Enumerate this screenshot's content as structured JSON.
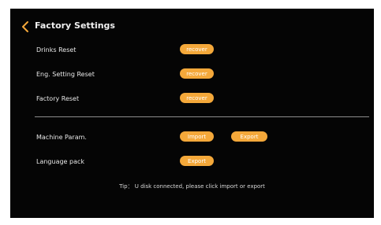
{
  "header": {
    "back_icon": "chevron-left-icon",
    "title": "Factory Settings"
  },
  "reset_section": {
    "drinks_label": "Drinks Reset",
    "drinks_button": "recover",
    "eng_label": "Eng. Setting Reset",
    "eng_button": "recover",
    "factory_label": "Factory Reset",
    "factory_button": "recover"
  },
  "usb_section": {
    "machine_label": "Machine Param.",
    "import_button": "Import",
    "export_button": "Export",
    "language_label": "Language pack",
    "language_export_button": "Export"
  },
  "tip": "Tip： U disk connected, please click import or export",
  "colors": {
    "background": "#050505",
    "button": "#f4a83a",
    "back_icon": "#f4a83a",
    "divider": "#8d8d8d"
  }
}
